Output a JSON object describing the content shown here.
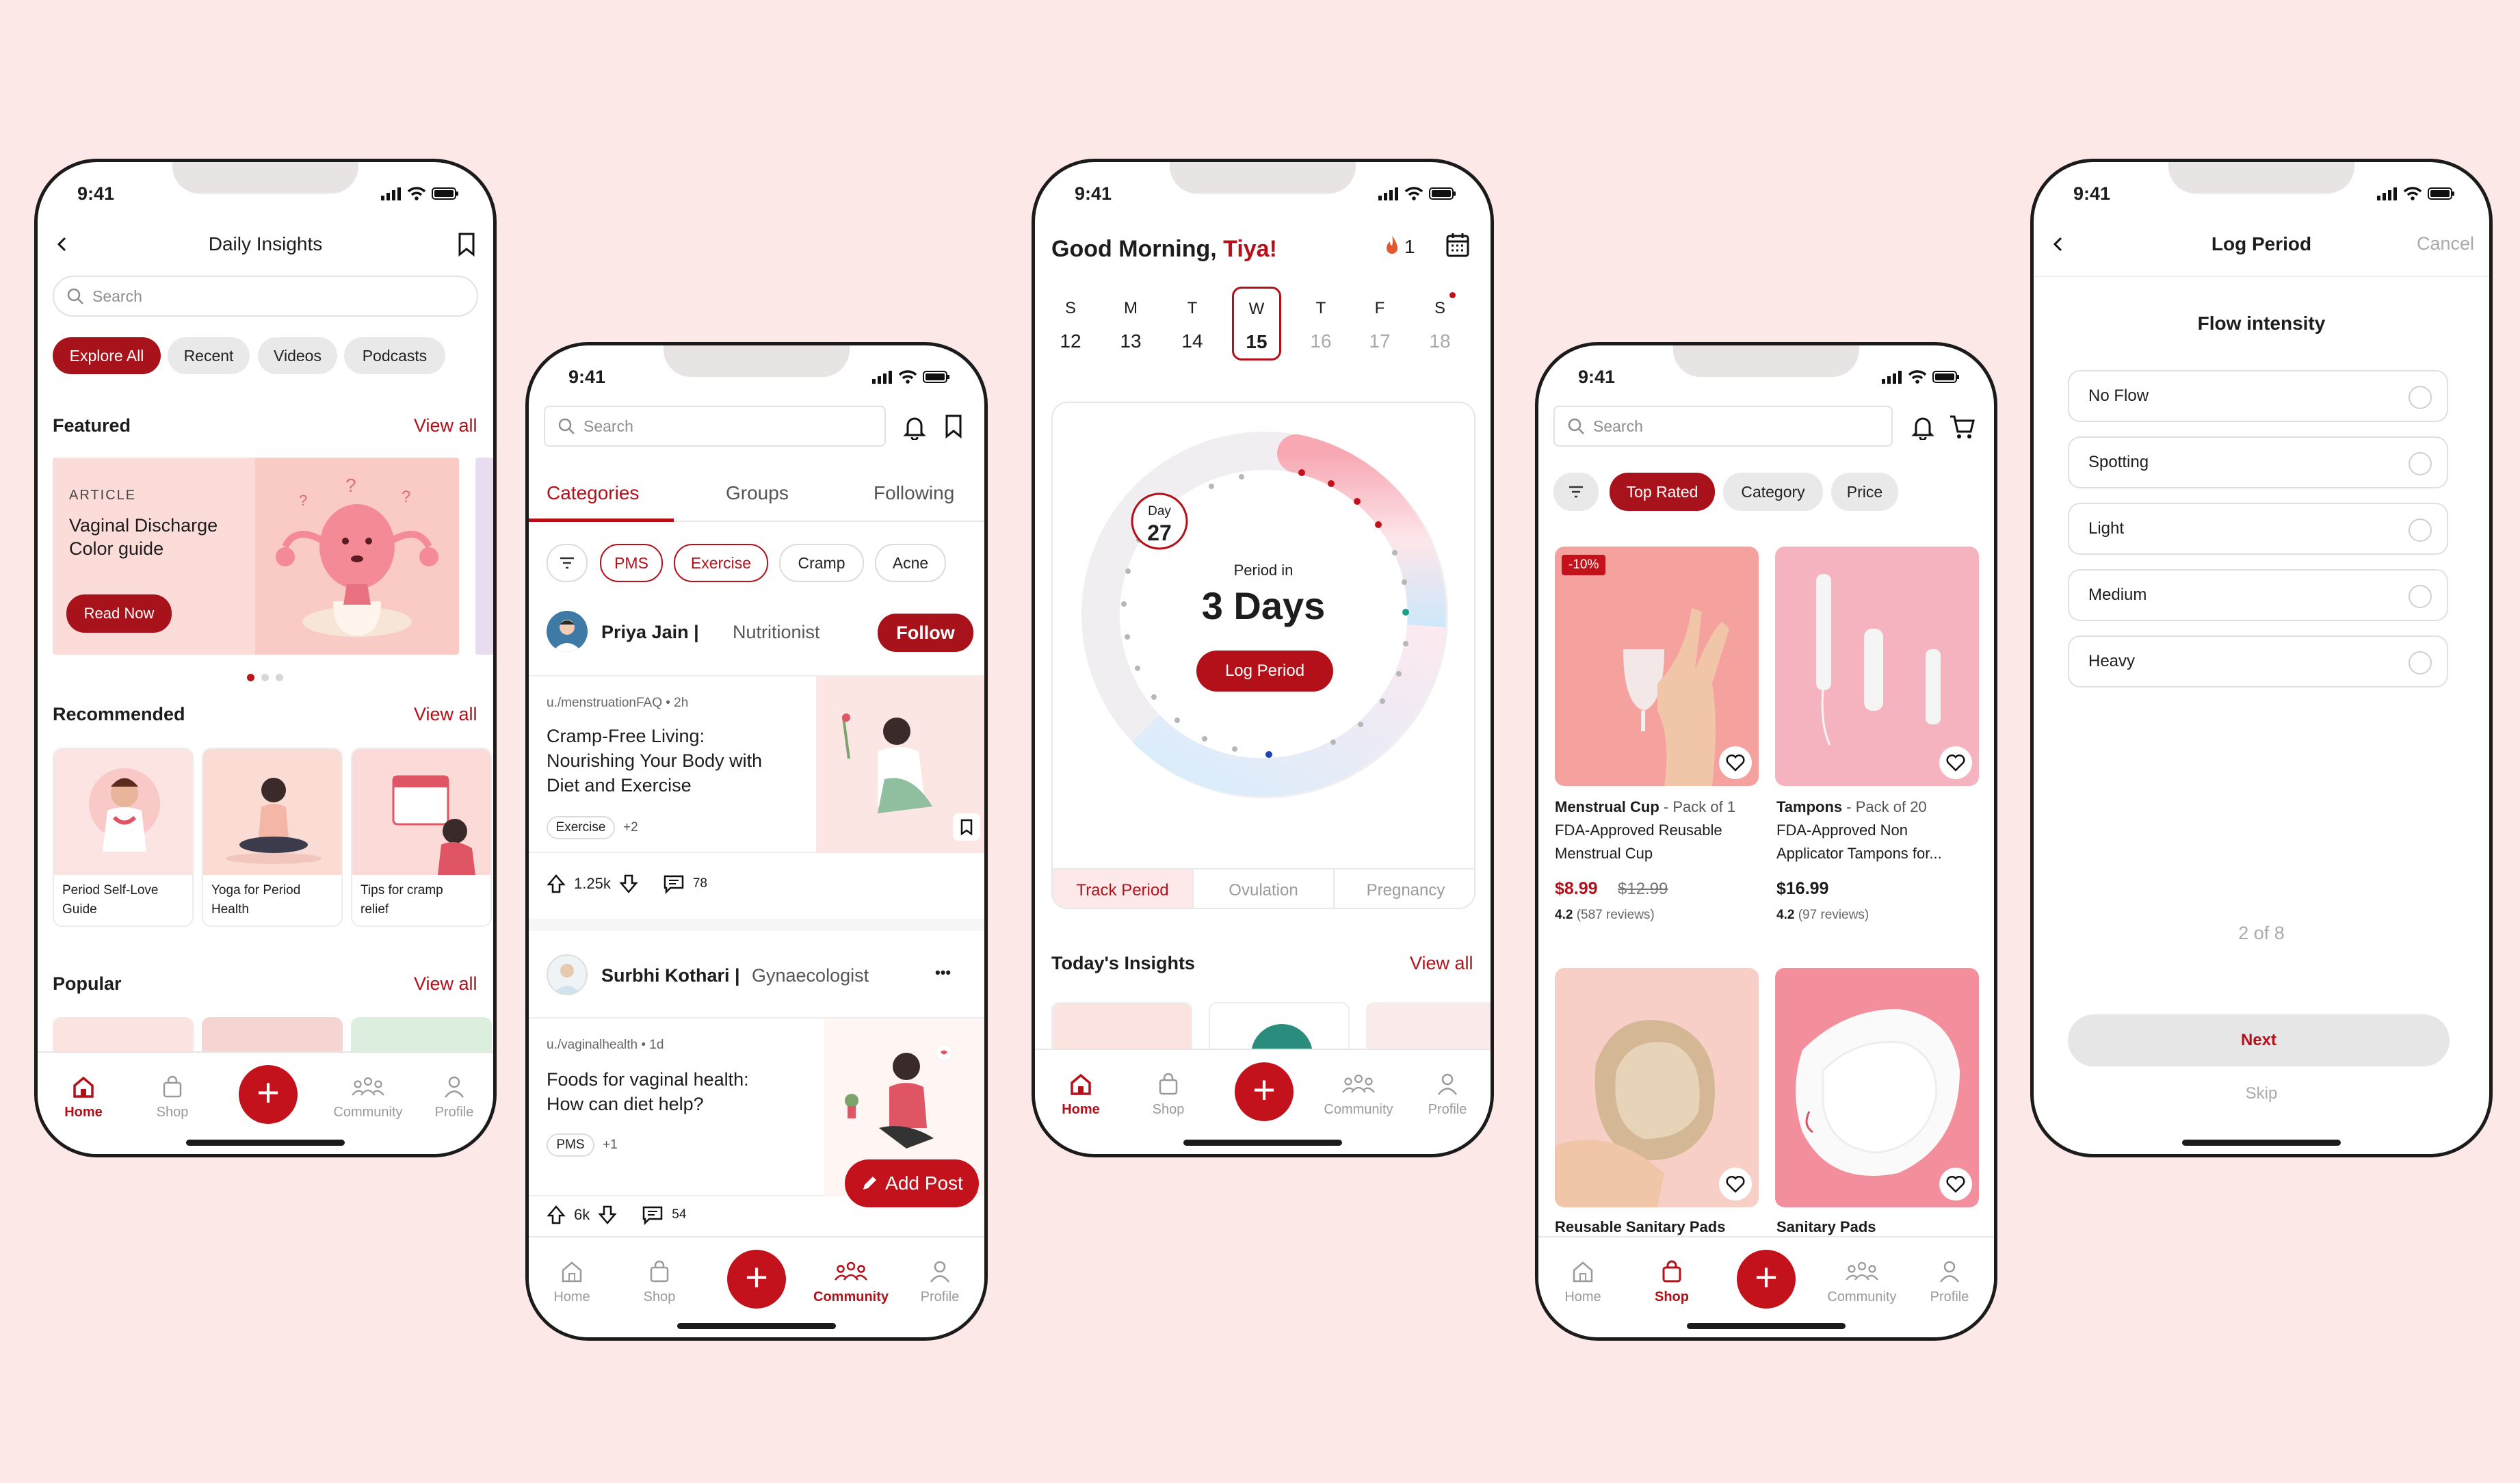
{
  "status_time": "9:41",
  "nav": {
    "home": "Home",
    "shop": "Shop",
    "community": "Community",
    "profile": "Profile",
    "fab": "+"
  },
  "insights": {
    "title": "Daily Insights",
    "search_placeholder": "Search",
    "filters": [
      "Explore All",
      "Recent",
      "Videos",
      "Podcasts"
    ],
    "featured_label": "Featured",
    "view_all": "View all",
    "article_tag": "ARTICLE",
    "article_title_1": "Vaginal Discharge",
    "article_title_2": "Color guide",
    "read_now": "Read Now",
    "recommended_label": "Recommended",
    "recommended": [
      {
        "l1": "Period Self-Love",
        "l2": "Guide"
      },
      {
        "l1": "Yoga for Period",
        "l2": "Health"
      },
      {
        "l1": "Tips for cramp",
        "l2": "relief"
      }
    ],
    "popular_label": "Popular"
  },
  "community": {
    "search_placeholder": "Search",
    "tabs": [
      "Categories",
      "Groups",
      "Following"
    ],
    "chips": [
      "PMS",
      "Exercise",
      "Cramp",
      "Acne"
    ],
    "author1": {
      "name": "Priya Jain |",
      "role": "Nutritionist",
      "follow": "Follow"
    },
    "post1": {
      "meta": "u./menstruationFAQ • 2h",
      "l1": "Cramp-Free Living:",
      "l2": "Nourishing Your Body with",
      "l3": "Diet and Exercise",
      "tag": "Exercise",
      "more": "+2",
      "votes": "1.25k",
      "comments": "78"
    },
    "author2": {
      "name": "Surbhi Kothari |",
      "role": "Gynaecologist",
      "menu": "•••"
    },
    "post2": {
      "meta": "u./vaginalhealth • 1d",
      "l1": "Foods for vaginal health:",
      "l2": "How can diet help?",
      "tag": "PMS",
      "more": "+1",
      "votes": "6k",
      "comments": "54"
    },
    "add_post": "Add Post"
  },
  "tracker": {
    "greeting": "Good Morning,",
    "name": "Tiya!",
    "streak": "1",
    "days": [
      {
        "d": "S",
        "n": "12"
      },
      {
        "d": "M",
        "n": "13"
      },
      {
        "d": "T",
        "n": "14"
      },
      {
        "d": "W",
        "n": "15"
      },
      {
        "d": "T",
        "n": "16"
      },
      {
        "d": "F",
        "n": "17"
      },
      {
        "d": "S",
        "n": "18"
      }
    ],
    "day_label": "Day",
    "day_num": "27",
    "period_in": "Period in",
    "days_left": "3 Days",
    "log_period": "Log Period",
    "tabs": [
      "Track Period",
      "Ovulation",
      "Pregnancy"
    ],
    "insights_label": "Today's Insights",
    "view_all": "View all"
  },
  "shop": {
    "search_placeholder": "Search",
    "filters": [
      "Top Rated",
      "Category",
      "Price"
    ],
    "discount": "-10%",
    "p1": {
      "name": "Menstrual Cup",
      "pack": " - Pack of 1",
      "d1": "FDA-Approved Reusable",
      "d2": "Menstrual Cup",
      "price": "$8.99",
      "old": "$12.99",
      "rating": "4.2",
      "reviews": "(587 reviews)"
    },
    "p2": {
      "name": "Tampons",
      "pack": " - Pack of 20",
      "d1": "FDA-Approved Non",
      "d2": "Applicator Tampons for...",
      "price": "$16.99",
      "rating": "4.2",
      "reviews": "(97 reviews)"
    },
    "p3": {
      "name": "Reusable Sanitary Pads"
    },
    "p4": {
      "name": "Sanitary Pads"
    }
  },
  "log": {
    "title": "Log Period",
    "cancel": "Cancel",
    "question": "Flow intensity",
    "options": [
      "No Flow",
      "Spotting",
      "Light",
      "Medium",
      "Heavy"
    ],
    "progress": "2 of 8",
    "next": "Next",
    "skip": "Skip"
  },
  "colors": {
    "accent": "#b3101a",
    "background": "#fde8e8"
  }
}
